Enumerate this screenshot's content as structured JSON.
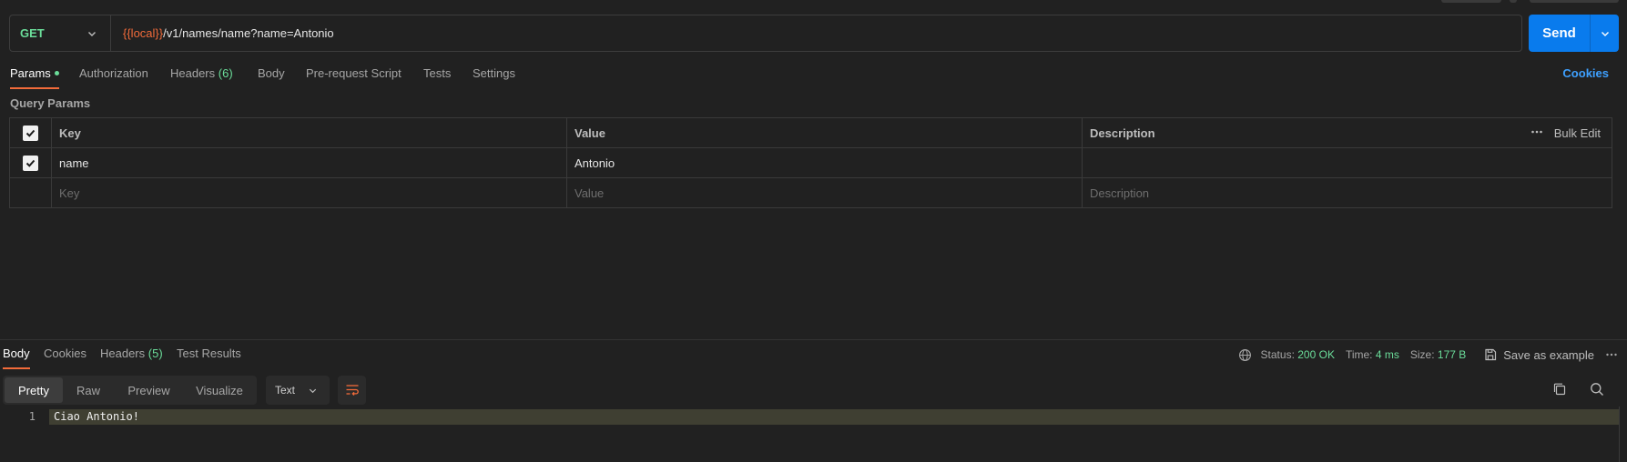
{
  "request": {
    "method": "GET",
    "url_variable": "{{local}}",
    "url_path": "/v1/names/name?name=Antonio",
    "send_label": "Send"
  },
  "request_tabs": [
    {
      "label": "Params",
      "active": true,
      "indicator": true
    },
    {
      "label": "Authorization",
      "active": false
    },
    {
      "label": "Headers",
      "count": "(6)",
      "active": false
    },
    {
      "label": "Body",
      "active": false
    },
    {
      "label": "Pre-request Script",
      "active": false
    },
    {
      "label": "Tests",
      "active": false
    },
    {
      "label": "Settings",
      "active": false
    }
  ],
  "cookies_link": "Cookies",
  "query_params": {
    "title": "Query Params",
    "headers": {
      "key": "Key",
      "value": "Value",
      "description": "Description",
      "bulk_edit": "Bulk Edit"
    },
    "rows": [
      {
        "checked": true,
        "key": "name",
        "value": "Antonio",
        "description": ""
      }
    ],
    "placeholders": {
      "key": "Key",
      "value": "Value",
      "description": "Description"
    }
  },
  "response_tabs": [
    {
      "label": "Body",
      "active": true
    },
    {
      "label": "Cookies",
      "active": false
    },
    {
      "label": "Headers",
      "count": "(5)",
      "active": false
    },
    {
      "label": "Test Results",
      "active": false
    }
  ],
  "response_status": {
    "status_label": "Status:",
    "status_value": "200 OK",
    "time_label": "Time:",
    "time_value": "4 ms",
    "size_label": "Size:",
    "size_value": "177 B",
    "save_example": "Save as example"
  },
  "view_modes": [
    "Pretty",
    "Raw",
    "Preview",
    "Visualize"
  ],
  "active_view_mode": "Pretty",
  "format_select": "Text",
  "response_body": [
    {
      "line": "1",
      "text": "Ciao Antonio!"
    }
  ],
  "colors": {
    "accent_orange": "#f26b3a",
    "send_blue": "#097bed",
    "success_green": "#6bdd9a",
    "link_blue": "#3ea0ff"
  },
  "icons": [
    "chevron-down-icon",
    "globe-icon",
    "save-icon",
    "more-icon",
    "wrap-lines-icon",
    "copy-icon",
    "search-icon",
    "check-icon"
  ]
}
